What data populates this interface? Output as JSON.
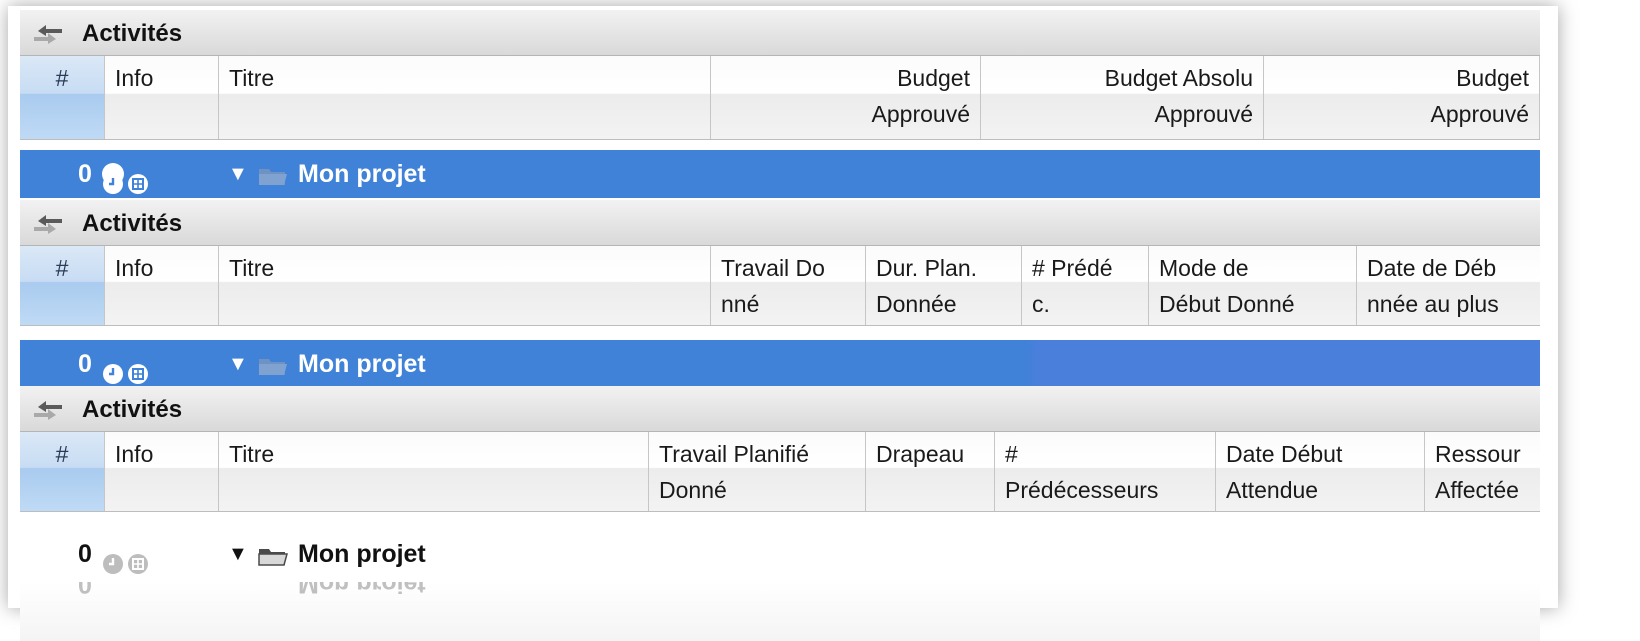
{
  "panels": [
    {
      "title": "Activités",
      "columns": [
        {
          "l1": "#",
          "l2": ""
        },
        {
          "l1": "Info",
          "l2": ""
        },
        {
          "l1": "Titre",
          "l2": ""
        },
        {
          "l1": "Budget",
          "l2": "Approuvé"
        },
        {
          "l1": "Budget Absolu",
          "l2": "Approuvé"
        },
        {
          "l1": "Budget",
          "l2": "Approuvé"
        }
      ],
      "row": {
        "num": "0",
        "title": "Mon projet",
        "expander": "▼"
      }
    },
    {
      "title": "Activités",
      "columns": [
        {
          "l1": "#",
          "l2": ""
        },
        {
          "l1": "Info",
          "l2": ""
        },
        {
          "l1": "Titre",
          "l2": ""
        },
        {
          "l1": "Travail Do",
          "l2": "nné"
        },
        {
          "l1": "Dur. Plan.",
          "l2": "Donnée"
        },
        {
          "l1": "# Prédé",
          "l2": "c."
        },
        {
          "l1": "Mode de",
          "l2": "Début Donné"
        },
        {
          "l1": "Date de Déb",
          "l2": "nnée au plus"
        }
      ],
      "row": {
        "num": "0",
        "title": "Mon projet",
        "expander": "▼"
      }
    },
    {
      "title": "Activités",
      "columns": [
        {
          "l1": "#",
          "l2": ""
        },
        {
          "l1": "Info",
          "l2": ""
        },
        {
          "l1": "Titre",
          "l2": ""
        },
        {
          "l1": "Travail Planifié",
          "l2": "Donné"
        },
        {
          "l1": "Drapeau",
          "l2": ""
        },
        {
          "l1": "#",
          "l2": "Prédécesseurs"
        },
        {
          "l1": "Date Début",
          "l2": "Attendue"
        },
        {
          "l1": "Ressour",
          "l2": "Affectée"
        }
      ],
      "row": {
        "num": "0",
        "title": "Mon projet",
        "expander": "▼"
      }
    }
  ],
  "reflection": {
    "num": "0",
    "title": "Mon projet"
  },
  "colors": {
    "selection": "#3f82d8",
    "header_num": "#bfdaf5"
  },
  "icons": [
    "transfer-arrows-icon",
    "clock-icon",
    "grid-icon",
    "folder-icon",
    "disclosure-triangle-icon"
  ]
}
